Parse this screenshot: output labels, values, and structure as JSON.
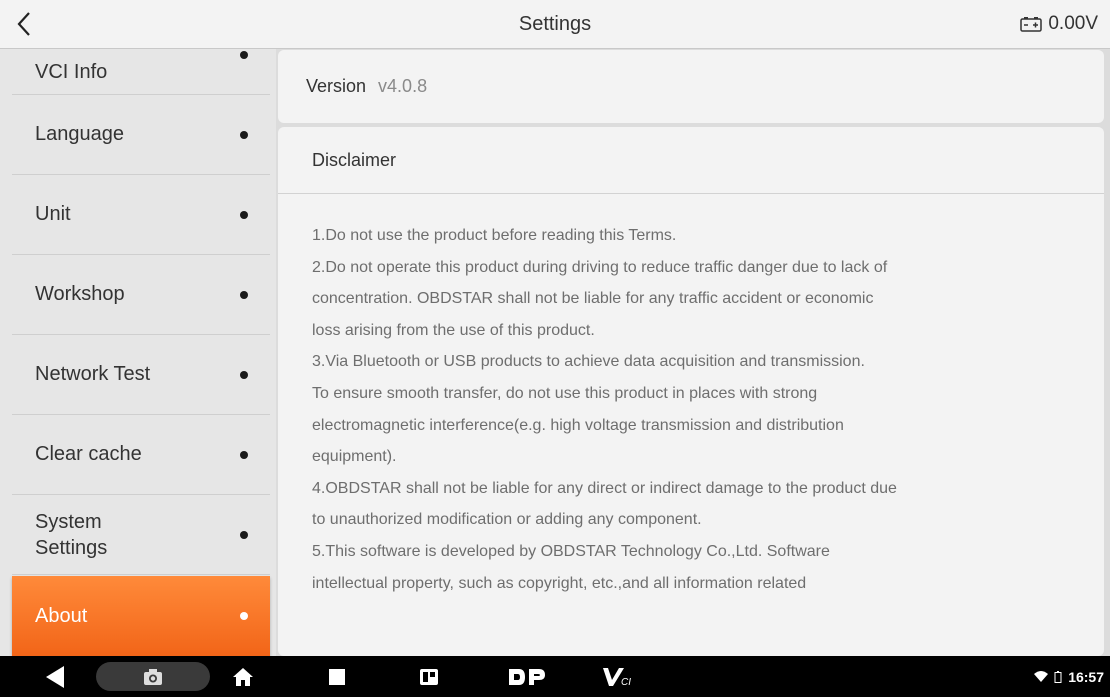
{
  "header": {
    "title": "Settings",
    "voltage": "0.00V"
  },
  "sidebar": {
    "items": [
      {
        "label": "VCI Info"
      },
      {
        "label": "Language"
      },
      {
        "label": "Unit"
      },
      {
        "label": "Workshop"
      },
      {
        "label": "Network Test"
      },
      {
        "label": "Clear cache"
      },
      {
        "label": "System Settings"
      },
      {
        "label": "About",
        "active": true
      }
    ]
  },
  "main": {
    "version_label": "Version",
    "version_value": "v4.0.8",
    "disclaimer_title": "Disclaimer",
    "disclaimer_lines": [
      "1.Do not use the product before reading this Terms.",
      "2.Do not operate this product during driving to reduce traffic danger due to lack of",
      "concentration. OBDSTAR shall not be liable for any traffic accident or economic",
      "loss arising from the use of this product.",
      "3.Via Bluetooth or USB products to achieve data acquisition and transmission.",
      "To ensure smooth transfer, do not use this product in places with strong",
      "electromagnetic interference(e.g. high voltage transmission and distribution",
      "equipment).",
      "4.OBDSTAR shall not be liable for any direct or indirect damage to the product due",
      "to unauthorized modification or adding any component.",
      "5.This software is developed by OBDSTAR Technology Co.,Ltd. Software",
      "intellectual property, such as copyright, etc.,and all information related"
    ]
  },
  "navbar": {
    "time": "16:57",
    "icons": [
      "back-icon",
      "screenshot-icon",
      "home-icon",
      "recents-icon",
      "app-icon",
      "dp-icon",
      "vci-icon",
      "wifi-icon",
      "battery-icon"
    ]
  },
  "colors": {
    "accent": "#f26518",
    "header_bg": "#f3f3f3",
    "sidebar_bg": "#e6e6e6",
    "navbar_bg": "#000000"
  }
}
